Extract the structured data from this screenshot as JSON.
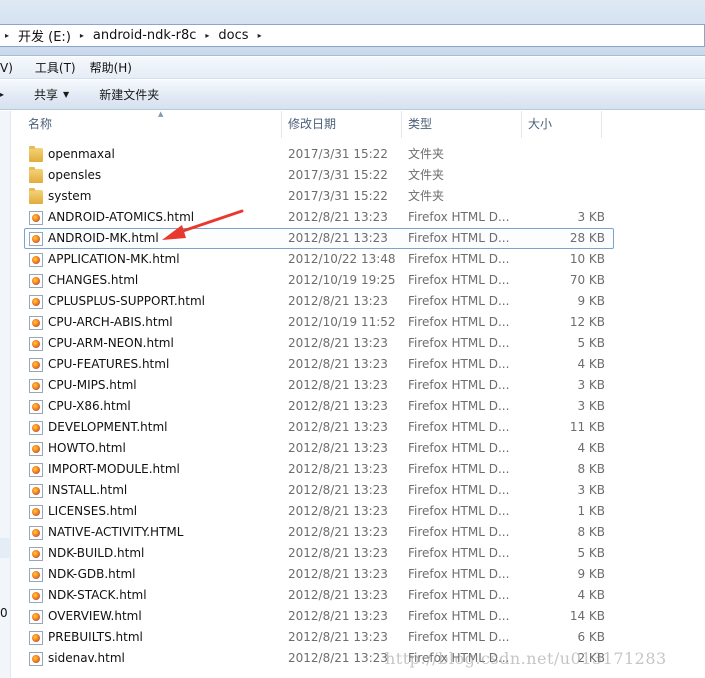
{
  "breadcrumb": {
    "lead_arrow": "▸",
    "items": [
      "开发 (E:)",
      "android-ndk-r8c",
      "docs"
    ]
  },
  "menu": {
    "items": [
      "V)",
      "工具(T)",
      "帮助(H)"
    ]
  },
  "toolbar": {
    "lead_arrow": "▸",
    "share_label": "共享",
    "new_folder_label": "新建文件夹"
  },
  "columns": {
    "name": "名称",
    "date": "修改日期",
    "type": "类型",
    "size": "大小"
  },
  "left_edge_text": "0",
  "files": [
    {
      "name": "openmaxal",
      "date": "2017/3/31 15:22",
      "type": "文件夹",
      "size": "",
      "icon": "folder-icon"
    },
    {
      "name": "opensles",
      "date": "2017/3/31 15:22",
      "type": "文件夹",
      "size": "",
      "icon": "folder-icon"
    },
    {
      "name": "system",
      "date": "2017/3/31 15:22",
      "type": "文件夹",
      "size": "",
      "icon": "folder-icon"
    },
    {
      "name": "ANDROID-ATOMICS.html",
      "date": "2012/8/21 13:23",
      "type": "Firefox HTML D...",
      "size": "3 KB",
      "icon": "firefox-html-icon"
    },
    {
      "name": "ANDROID-MK.html",
      "date": "2012/8/21 13:23",
      "type": "Firefox HTML D...",
      "size": "28 KB",
      "icon": "firefox-html-icon",
      "selected": true
    },
    {
      "name": "APPLICATION-MK.html",
      "date": "2012/10/22 13:48",
      "type": "Firefox HTML D...",
      "size": "10 KB",
      "icon": "firefox-html-icon"
    },
    {
      "name": "CHANGES.html",
      "date": "2012/10/19 19:25",
      "type": "Firefox HTML D...",
      "size": "70 KB",
      "icon": "firefox-html-icon"
    },
    {
      "name": "CPLUSPLUS-SUPPORT.html",
      "date": "2012/8/21 13:23",
      "type": "Firefox HTML D...",
      "size": "9 KB",
      "icon": "firefox-html-icon"
    },
    {
      "name": "CPU-ARCH-ABIS.html",
      "date": "2012/10/19 11:52",
      "type": "Firefox HTML D...",
      "size": "12 KB",
      "icon": "firefox-html-icon"
    },
    {
      "name": "CPU-ARM-NEON.html",
      "date": "2012/8/21 13:23",
      "type": "Firefox HTML D...",
      "size": "5 KB",
      "icon": "firefox-html-icon"
    },
    {
      "name": "CPU-FEATURES.html",
      "date": "2012/8/21 13:23",
      "type": "Firefox HTML D...",
      "size": "4 KB",
      "icon": "firefox-html-icon"
    },
    {
      "name": "CPU-MIPS.html",
      "date": "2012/8/21 13:23",
      "type": "Firefox HTML D...",
      "size": "3 KB",
      "icon": "firefox-html-icon"
    },
    {
      "name": "CPU-X86.html",
      "date": "2012/8/21 13:23",
      "type": "Firefox HTML D...",
      "size": "3 KB",
      "icon": "firefox-html-icon"
    },
    {
      "name": "DEVELOPMENT.html",
      "date": "2012/8/21 13:23",
      "type": "Firefox HTML D...",
      "size": "11 KB",
      "icon": "firefox-html-icon"
    },
    {
      "name": "HOWTO.html",
      "date": "2012/8/21 13:23",
      "type": "Firefox HTML D...",
      "size": "4 KB",
      "icon": "firefox-html-icon"
    },
    {
      "name": "IMPORT-MODULE.html",
      "date": "2012/8/21 13:23",
      "type": "Firefox HTML D...",
      "size": "8 KB",
      "icon": "firefox-html-icon"
    },
    {
      "name": "INSTALL.html",
      "date": "2012/8/21 13:23",
      "type": "Firefox HTML D...",
      "size": "3 KB",
      "icon": "firefox-html-icon"
    },
    {
      "name": "LICENSES.html",
      "date": "2012/8/21 13:23",
      "type": "Firefox HTML D...",
      "size": "1 KB",
      "icon": "firefox-html-icon"
    },
    {
      "name": "NATIVE-ACTIVITY.HTML",
      "date": "2012/8/21 13:23",
      "type": "Firefox HTML D...",
      "size": "8 KB",
      "icon": "firefox-html-icon"
    },
    {
      "name": "NDK-BUILD.html",
      "date": "2012/8/21 13:23",
      "type": "Firefox HTML D...",
      "size": "5 KB",
      "icon": "firefox-html-icon"
    },
    {
      "name": "NDK-GDB.html",
      "date": "2012/8/21 13:23",
      "type": "Firefox HTML D...",
      "size": "9 KB",
      "icon": "firefox-html-icon"
    },
    {
      "name": "NDK-STACK.html",
      "date": "2012/8/21 13:23",
      "type": "Firefox HTML D...",
      "size": "4 KB",
      "icon": "firefox-html-icon"
    },
    {
      "name": "OVERVIEW.html",
      "date": "2012/8/21 13:23",
      "type": "Firefox HTML D...",
      "size": "14 KB",
      "icon": "firefox-html-icon"
    },
    {
      "name": "PREBUILTS.html",
      "date": "2012/8/21 13:23",
      "type": "Firefox HTML D...",
      "size": "6 KB",
      "icon": "firefox-html-icon"
    },
    {
      "name": "sidenav.html",
      "date": "2012/8/21 13:23",
      "type": "Firefox HTML D...",
      "size": "2 KB",
      "icon": "firefox-html-icon"
    }
  ],
  "annotation": {
    "arrow_color": "#e8392f"
  },
  "watermark": "http://blog.csdn.net/u013171283"
}
